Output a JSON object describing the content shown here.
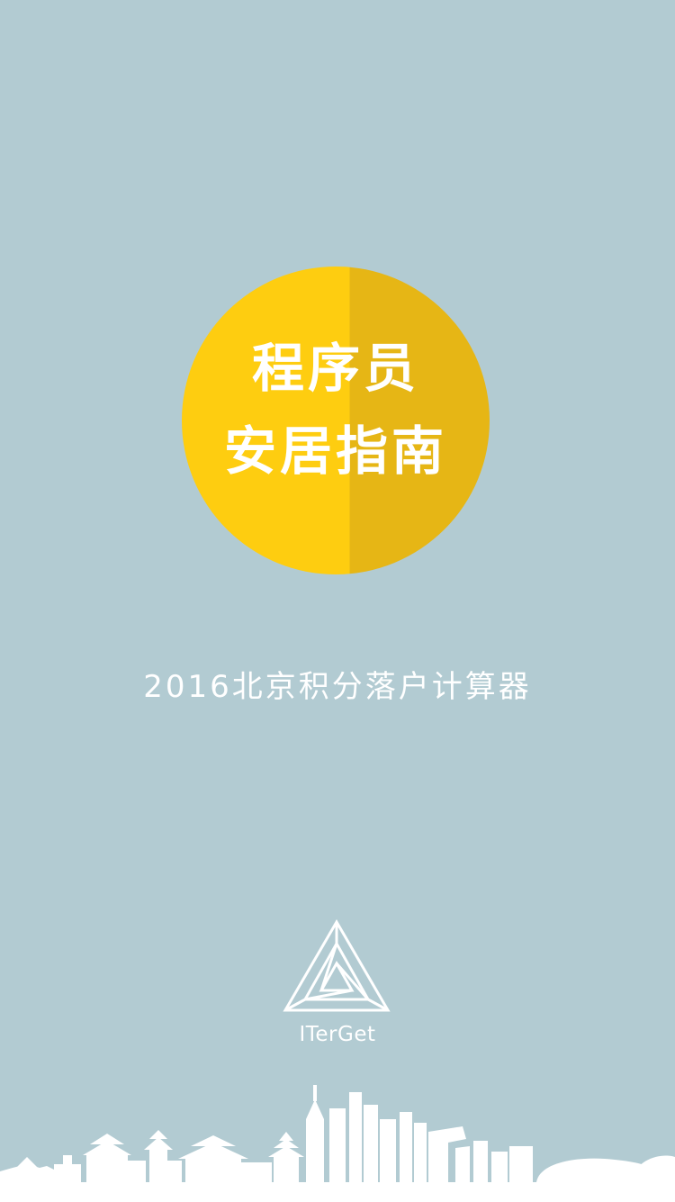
{
  "splash": {
    "title_line1": "程序员",
    "title_line2": "安居指南",
    "subtitle": "2016北京积分落户计算器",
    "brand_name": "ITerGet",
    "logo_icon": "impossible-triangle-icon",
    "skyline_image": "beijing-skyline-silhouette"
  },
  "colors": {
    "background": "#b2cbd2",
    "badge_light": "#fecd10",
    "badge_dark": "#e6b615",
    "text": "#ffffff"
  }
}
